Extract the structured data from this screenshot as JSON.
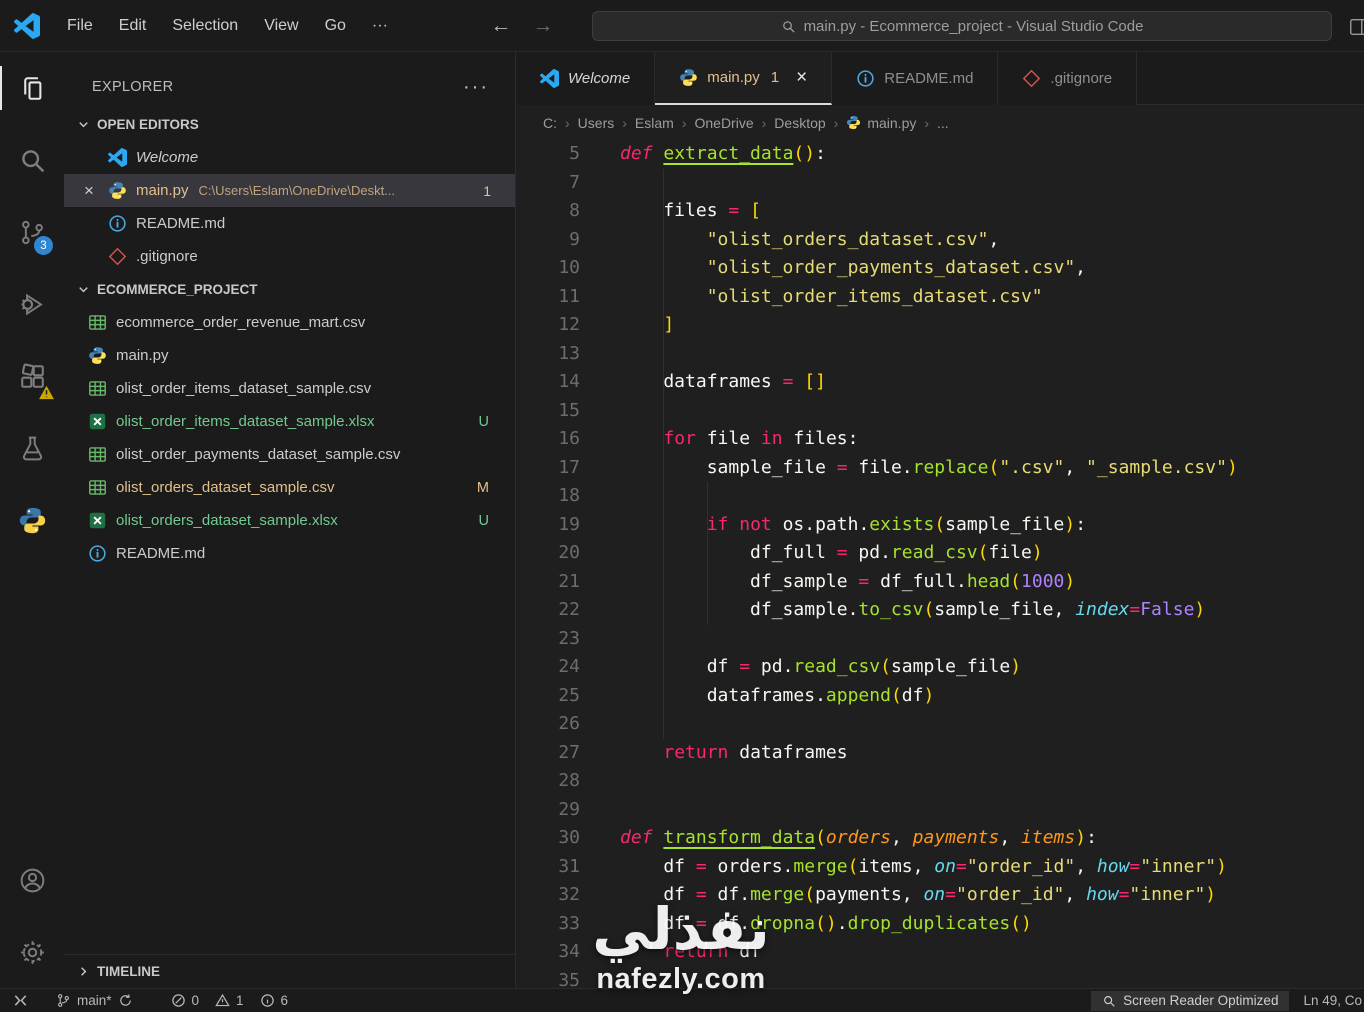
{
  "window": {
    "menus": [
      "File",
      "Edit",
      "Selection",
      "View",
      "Go",
      "···"
    ],
    "search_text": "main.py - Ecommerce_project - Visual Studio Code",
    "back_arrow": "←",
    "forward_arrow": "→"
  },
  "activity_bar": {
    "top": [
      {
        "name": "explorer",
        "icon": "files-icon",
        "active": true
      },
      {
        "name": "search",
        "icon": "search-icon"
      },
      {
        "name": "source-control",
        "icon": "source-control-icon",
        "badge": "3"
      },
      {
        "name": "run-debug",
        "icon": "debug-icon"
      },
      {
        "name": "extensions",
        "icon": "extensions-icon",
        "warn": true
      },
      {
        "name": "testing",
        "icon": "beaker-icon"
      },
      {
        "name": "python",
        "icon": "python-icon"
      }
    ],
    "bottom": [
      {
        "name": "account",
        "icon": "account-icon"
      },
      {
        "name": "settings",
        "icon": "gear-icon"
      }
    ]
  },
  "sidebar": {
    "title": "EXPLORER",
    "actions": "···",
    "open_editors": {
      "label": "OPEN EDITORS",
      "items": [
        {
          "icon": "vscode-icon",
          "name": "Welcome",
          "italic": true
        },
        {
          "icon": "python-file-icon",
          "name": "main.py",
          "desc": "C:\\Users\\Eslam\\OneDrive\\Deskt...",
          "badge": "1",
          "selected": true,
          "modified": true,
          "closable": true
        },
        {
          "icon": "info-icon",
          "name": "README.md"
        },
        {
          "icon": "gitignore-icon",
          "name": ".gitignore"
        }
      ]
    },
    "project": {
      "label": "ECOMMERCE_PROJECT",
      "files": [
        {
          "icon": "csv-icon",
          "name": "ecommerce_order_revenue_mart.csv"
        },
        {
          "icon": "python-file-icon",
          "name": "main.py"
        },
        {
          "icon": "csv-icon",
          "name": "olist_order_items_dataset_sample.csv"
        },
        {
          "icon": "xlsx-icon",
          "name": "olist_order_items_dataset_sample.xlsx",
          "git": "U",
          "color": "green"
        },
        {
          "icon": "csv-icon",
          "name": "olist_order_payments_dataset_sample.csv"
        },
        {
          "icon": "csv-icon",
          "name": "olist_orders_dataset_sample.csv",
          "git": "M",
          "color": "gold"
        },
        {
          "icon": "xlsx-icon",
          "name": "olist_orders_dataset_sample.xlsx",
          "git": "U",
          "color": "green"
        },
        {
          "icon": "info-icon",
          "name": "README.md"
        }
      ]
    },
    "timeline_label": "TIMELINE"
  },
  "tabs": [
    {
      "icon": "vscode-icon",
      "label": "Welcome",
      "italic": true
    },
    {
      "icon": "python-file-icon",
      "label": "main.py",
      "badge": "1",
      "close": "×",
      "active": true
    },
    {
      "icon": "info-icon",
      "label": "README.md"
    },
    {
      "icon": "gitignore-icon",
      "label": ".gitignore"
    }
  ],
  "breadcrumb": [
    {
      "label": "C:"
    },
    {
      "label": "Users"
    },
    {
      "label": "Eslam"
    },
    {
      "label": "OneDrive"
    },
    {
      "label": "Desktop"
    },
    {
      "label": "main.py",
      "icon": "python-file-icon"
    },
    {
      "label": "..."
    }
  ],
  "editor": {
    "code_lines": [
      {
        "n": "5",
        "tokens": [
          [
            "kwi",
            "def"
          ],
          [
            "pl",
            " "
          ],
          [
            "fn",
            "extract_data"
          ],
          [
            "br",
            "("
          ],
          [
            "br",
            ")"
          ],
          [
            "pl",
            ":"
          ]
        ]
      },
      {
        "n": "7",
        "tokens": []
      },
      {
        "n": "8",
        "tokens": [
          [
            "pl",
            "    files "
          ],
          [
            "op",
            "="
          ],
          [
            "pl",
            " "
          ],
          [
            "br",
            "["
          ]
        ]
      },
      {
        "n": "9",
        "tokens": [
          [
            "pl",
            "        "
          ],
          [
            "st",
            "\"olist_orders_dataset.csv\""
          ],
          [
            "pl",
            ","
          ]
        ]
      },
      {
        "n": "10",
        "tokens": [
          [
            "pl",
            "        "
          ],
          [
            "st",
            "\"olist_order_payments_dataset.csv\""
          ],
          [
            "pl",
            ","
          ]
        ]
      },
      {
        "n": "11",
        "tokens": [
          [
            "pl",
            "        "
          ],
          [
            "st",
            "\"olist_order_items_dataset.csv\""
          ]
        ]
      },
      {
        "n": "12",
        "tokens": [
          [
            "pl",
            "    "
          ],
          [
            "br",
            "]"
          ]
        ]
      },
      {
        "n": "13",
        "tokens": []
      },
      {
        "n": "14",
        "tokens": [
          [
            "pl",
            "    dataframes "
          ],
          [
            "op",
            "="
          ],
          [
            "pl",
            " "
          ],
          [
            "br",
            "[]"
          ]
        ]
      },
      {
        "n": "15",
        "tokens": []
      },
      {
        "n": "16",
        "tokens": [
          [
            "pl",
            "    "
          ],
          [
            "kw",
            "for"
          ],
          [
            "pl",
            " file "
          ],
          [
            "kw",
            "in"
          ],
          [
            "pl",
            " files:"
          ]
        ]
      },
      {
        "n": "17",
        "tokens": [
          [
            "pl",
            "        sample_file "
          ],
          [
            "op",
            "="
          ],
          [
            "pl",
            " file."
          ],
          [
            "ca",
            "replace"
          ],
          [
            "br",
            "("
          ],
          [
            "st",
            "\".csv\""
          ],
          [
            "pl",
            ", "
          ],
          [
            "st",
            "\"_sample.csv\""
          ],
          [
            "br",
            ")"
          ]
        ]
      },
      {
        "n": "18",
        "tokens": []
      },
      {
        "n": "19",
        "tokens": [
          [
            "pl",
            "        "
          ],
          [
            "kw",
            "if"
          ],
          [
            "pl",
            " "
          ],
          [
            "kw",
            "not"
          ],
          [
            "pl",
            " os.path."
          ],
          [
            "ca",
            "exists"
          ],
          [
            "br",
            "("
          ],
          [
            "pl",
            "sample_file"
          ],
          [
            "br",
            ")"
          ],
          [
            "pl",
            ":"
          ]
        ]
      },
      {
        "n": "20",
        "tokens": [
          [
            "pl",
            "            df_full "
          ],
          [
            "op",
            "="
          ],
          [
            "pl",
            " pd."
          ],
          [
            "ca",
            "read_csv"
          ],
          [
            "br",
            "("
          ],
          [
            "pl",
            "file"
          ],
          [
            "br",
            ")"
          ]
        ]
      },
      {
        "n": "21",
        "tokens": [
          [
            "pl",
            "            df_sample "
          ],
          [
            "op",
            "="
          ],
          [
            "pl",
            " df_full."
          ],
          [
            "ca",
            "head"
          ],
          [
            "br",
            "("
          ],
          [
            "nu",
            "1000"
          ],
          [
            "br",
            ")"
          ]
        ]
      },
      {
        "n": "22",
        "tokens": [
          [
            "pl",
            "            df_sample."
          ],
          [
            "ca",
            "to_csv"
          ],
          [
            "br",
            "("
          ],
          [
            "pl",
            "sample_file, "
          ],
          [
            "ka",
            "index"
          ],
          [
            "op",
            "="
          ],
          [
            "nu",
            "False"
          ],
          [
            "br",
            ")"
          ]
        ]
      },
      {
        "n": "23",
        "tokens": []
      },
      {
        "n": "24",
        "tokens": [
          [
            "pl",
            "        df "
          ],
          [
            "op",
            "="
          ],
          [
            "pl",
            " pd."
          ],
          [
            "ca",
            "read_csv"
          ],
          [
            "br",
            "("
          ],
          [
            "pl",
            "sample_file"
          ],
          [
            "br",
            ")"
          ]
        ]
      },
      {
        "n": "25",
        "tokens": [
          [
            "pl",
            "        dataframes."
          ],
          [
            "ca",
            "append"
          ],
          [
            "br",
            "("
          ],
          [
            "pl",
            "df"
          ],
          [
            "br",
            ")"
          ]
        ]
      },
      {
        "n": "26",
        "tokens": []
      },
      {
        "n": "27",
        "tokens": [
          [
            "pl",
            "    "
          ],
          [
            "kw",
            "return"
          ],
          [
            "pl",
            " dataframes"
          ]
        ]
      },
      {
        "n": "28",
        "tokens": []
      },
      {
        "n": "29",
        "tokens": []
      },
      {
        "n": "30",
        "tokens": [
          [
            "kwi",
            "def"
          ],
          [
            "pl",
            " "
          ],
          [
            "fn",
            "transform_data"
          ],
          [
            "br",
            "("
          ],
          [
            "par",
            "orders"
          ],
          [
            "pl",
            ", "
          ],
          [
            "par",
            "payments"
          ],
          [
            "pl",
            ", "
          ],
          [
            "par",
            "items"
          ],
          [
            "br",
            ")"
          ],
          [
            "pl",
            ":"
          ]
        ]
      },
      {
        "n": "31",
        "tokens": [
          [
            "pl",
            "    df "
          ],
          [
            "op",
            "="
          ],
          [
            "pl",
            " orders."
          ],
          [
            "ca",
            "merge"
          ],
          [
            "br",
            "("
          ],
          [
            "pl",
            "items, "
          ],
          [
            "ka",
            "on"
          ],
          [
            "op",
            "="
          ],
          [
            "st",
            "\"order_id\""
          ],
          [
            "pl",
            ", "
          ],
          [
            "ka",
            "how"
          ],
          [
            "op",
            "="
          ],
          [
            "st",
            "\"inner\""
          ],
          [
            "br",
            ")"
          ]
        ]
      },
      {
        "n": "32",
        "tokens": [
          [
            "pl",
            "    df "
          ],
          [
            "op",
            "="
          ],
          [
            "pl",
            " df."
          ],
          [
            "ca",
            "merge"
          ],
          [
            "br",
            "("
          ],
          [
            "pl",
            "payments, "
          ],
          [
            "ka",
            "on"
          ],
          [
            "op",
            "="
          ],
          [
            "st",
            "\"order_id\""
          ],
          [
            "pl",
            ", "
          ],
          [
            "ka",
            "how"
          ],
          [
            "op",
            "="
          ],
          [
            "st",
            "\"inner\""
          ],
          [
            "br",
            ")"
          ]
        ]
      },
      {
        "n": "33",
        "tokens": [
          [
            "pl",
            "    df "
          ],
          [
            "op",
            "="
          ],
          [
            "pl",
            " df."
          ],
          [
            "ca",
            "dropna"
          ],
          [
            "br",
            "()"
          ],
          [
            "pl",
            "."
          ],
          [
            "ca",
            "drop_duplicates"
          ],
          [
            "br",
            "()"
          ]
        ]
      },
      {
        "n": "34",
        "tokens": [
          [
            "pl",
            "    "
          ],
          [
            "kw",
            "return"
          ],
          [
            "pl",
            " df"
          ]
        ]
      },
      {
        "n": "35",
        "tokens": []
      }
    ]
  },
  "status_bar": {
    "branch": "main*",
    "errors": "0",
    "warnings": "1",
    "infos": "6",
    "screen_reader": "Screen Reader Optimized",
    "cursor": "Ln 49, Co"
  },
  "watermark": {
    "arabic": "نفذلي",
    "latin": "nafezly.com"
  }
}
